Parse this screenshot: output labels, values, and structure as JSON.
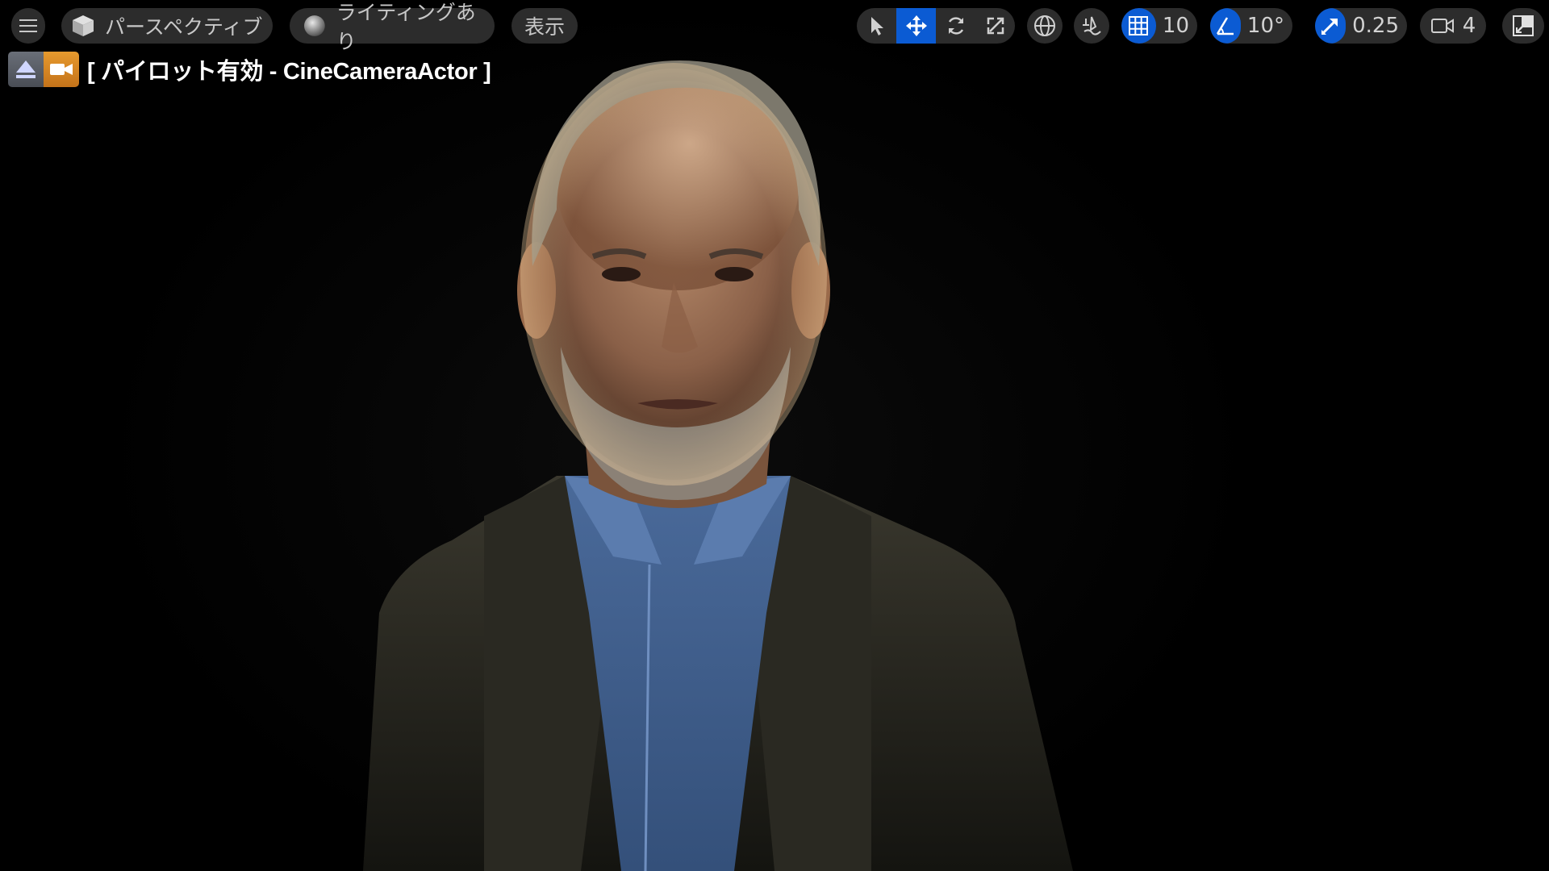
{
  "toolbar": {
    "menu_icon": "hamburger-icon",
    "perspective_label": "パースペクティブ",
    "perspective_icon": "cube-icon",
    "lighting_label": "ライティングあり",
    "lighting_icon": "sphere-icon",
    "show_label": "表示",
    "tools": [
      {
        "name": "select",
        "icon": "cursor-arrow-icon",
        "active": false
      },
      {
        "name": "translate",
        "icon": "move-arrows-icon",
        "active": true
      },
      {
        "name": "rotate",
        "icon": "rotate-icon",
        "active": false
      },
      {
        "name": "scale",
        "icon": "scale-icon",
        "active": false
      }
    ],
    "coordinate_space_icon": "globe-icon",
    "surface_snap_icon": "surface-snap-icon",
    "grid_snap_value": "10",
    "rotation_snap_value": "10°",
    "scale_snap_value": "0.25",
    "camera_speed_value": "4",
    "maximize_icon": "maximize-icon",
    "accent_color": "#0b5bd3"
  },
  "pilot": {
    "label": "[ パイロット有効 - CineCameraActor ]",
    "eject_icon": "eject-icon",
    "camera_icon": "cine-camera-icon",
    "badge_color": "#e08a22"
  }
}
